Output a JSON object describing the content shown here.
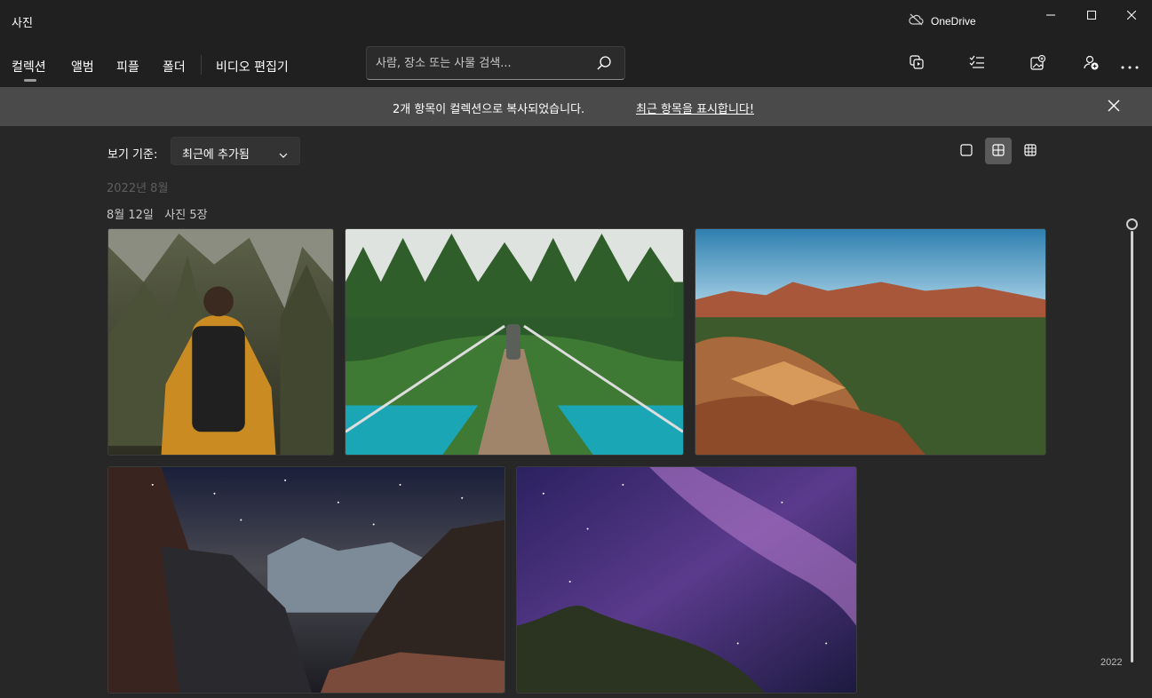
{
  "app": {
    "title": "사진"
  },
  "onedrive": {
    "label": "OneDrive",
    "icon": "cloud-off-icon"
  },
  "window_controls": [
    "minimize-icon",
    "maximize-icon",
    "close-icon"
  ],
  "nav": {
    "tabs": [
      {
        "label": "컬렉션",
        "selected": true
      },
      {
        "label": "앨범",
        "selected": false
      },
      {
        "label": "피플",
        "selected": false
      },
      {
        "label": "폴더",
        "selected": false
      }
    ],
    "video_editor": "비디오 편집기",
    "search_placeholder": "사람, 장소 또는 사물 검색...",
    "toolbar_icons": [
      "slideshow-icon",
      "select-icon",
      "import-icon",
      "add-person-icon",
      "more-icon"
    ]
  },
  "banner": {
    "message": "2개 항목이 컬렉션으로 복사되었습니다.",
    "link": "최근 항목을 표시합니다!"
  },
  "view": {
    "label": "보기 기준:",
    "sort_value": "최근에 추가됨",
    "size_modes": [
      "single-square-icon",
      "medium-grid-icon",
      "small-grid-icon"
    ],
    "selected_size_mode": "medium-grid-icon"
  },
  "groups": {
    "month": "2022년 8월",
    "day": "8월 12일",
    "count": "사진 5장"
  },
  "photos": [
    {
      "subject": "hiker-backpack-cliffs"
    },
    {
      "subject": "suspension-bridge-forest"
    },
    {
      "subject": "red-rock-canyon"
    },
    {
      "subject": "canyon-starry-night"
    },
    {
      "subject": "milky-way-purple-sky"
    }
  ],
  "timeline": {
    "year": "2022"
  }
}
